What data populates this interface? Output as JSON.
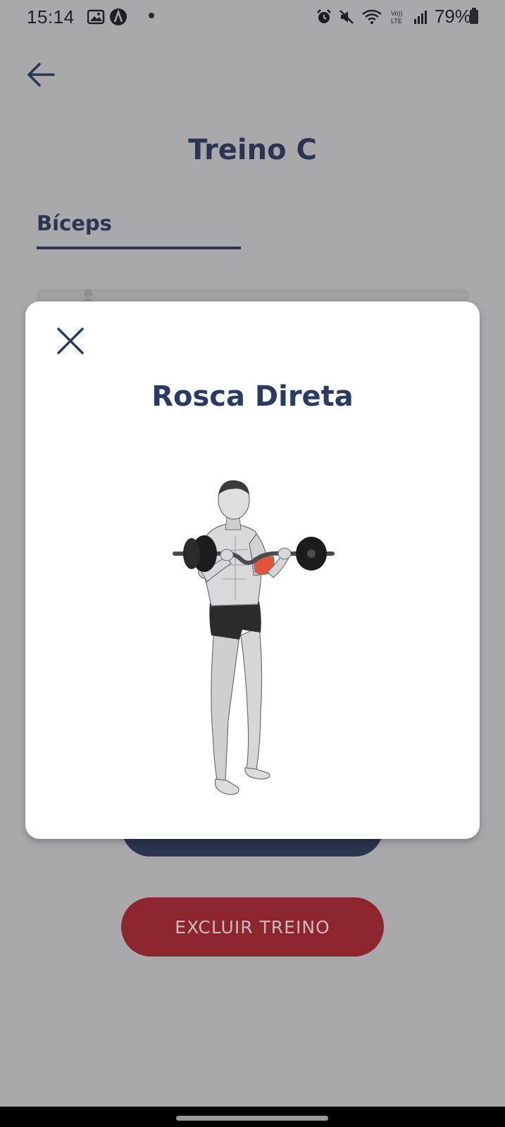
{
  "status_bar": {
    "time": "15:14",
    "battery_percent": "79%",
    "icons": [
      "gallery-icon",
      "app-icon",
      "notification-dot",
      "alarm-icon",
      "mute-icon",
      "wifi-icon",
      "volte-icon",
      "signal-icon",
      "battery-icon"
    ]
  },
  "header": {
    "back_icon": "arrow-left-icon",
    "title": "Treino C"
  },
  "tabs": [
    {
      "label": "Bíceps",
      "active": true
    }
  ],
  "modal": {
    "close_icon": "close-icon",
    "title": "Rosca Direta",
    "image": "barbell-curl-illustration"
  },
  "buttons": {
    "delete_label": "EXCLUIR TREINO"
  },
  "colors": {
    "overlay_background": "#a9a9ac",
    "title_color": "#2b3552",
    "modal_title_color": "#283a66",
    "delete_button": "#8d252e",
    "save_button": "#2b3550"
  }
}
